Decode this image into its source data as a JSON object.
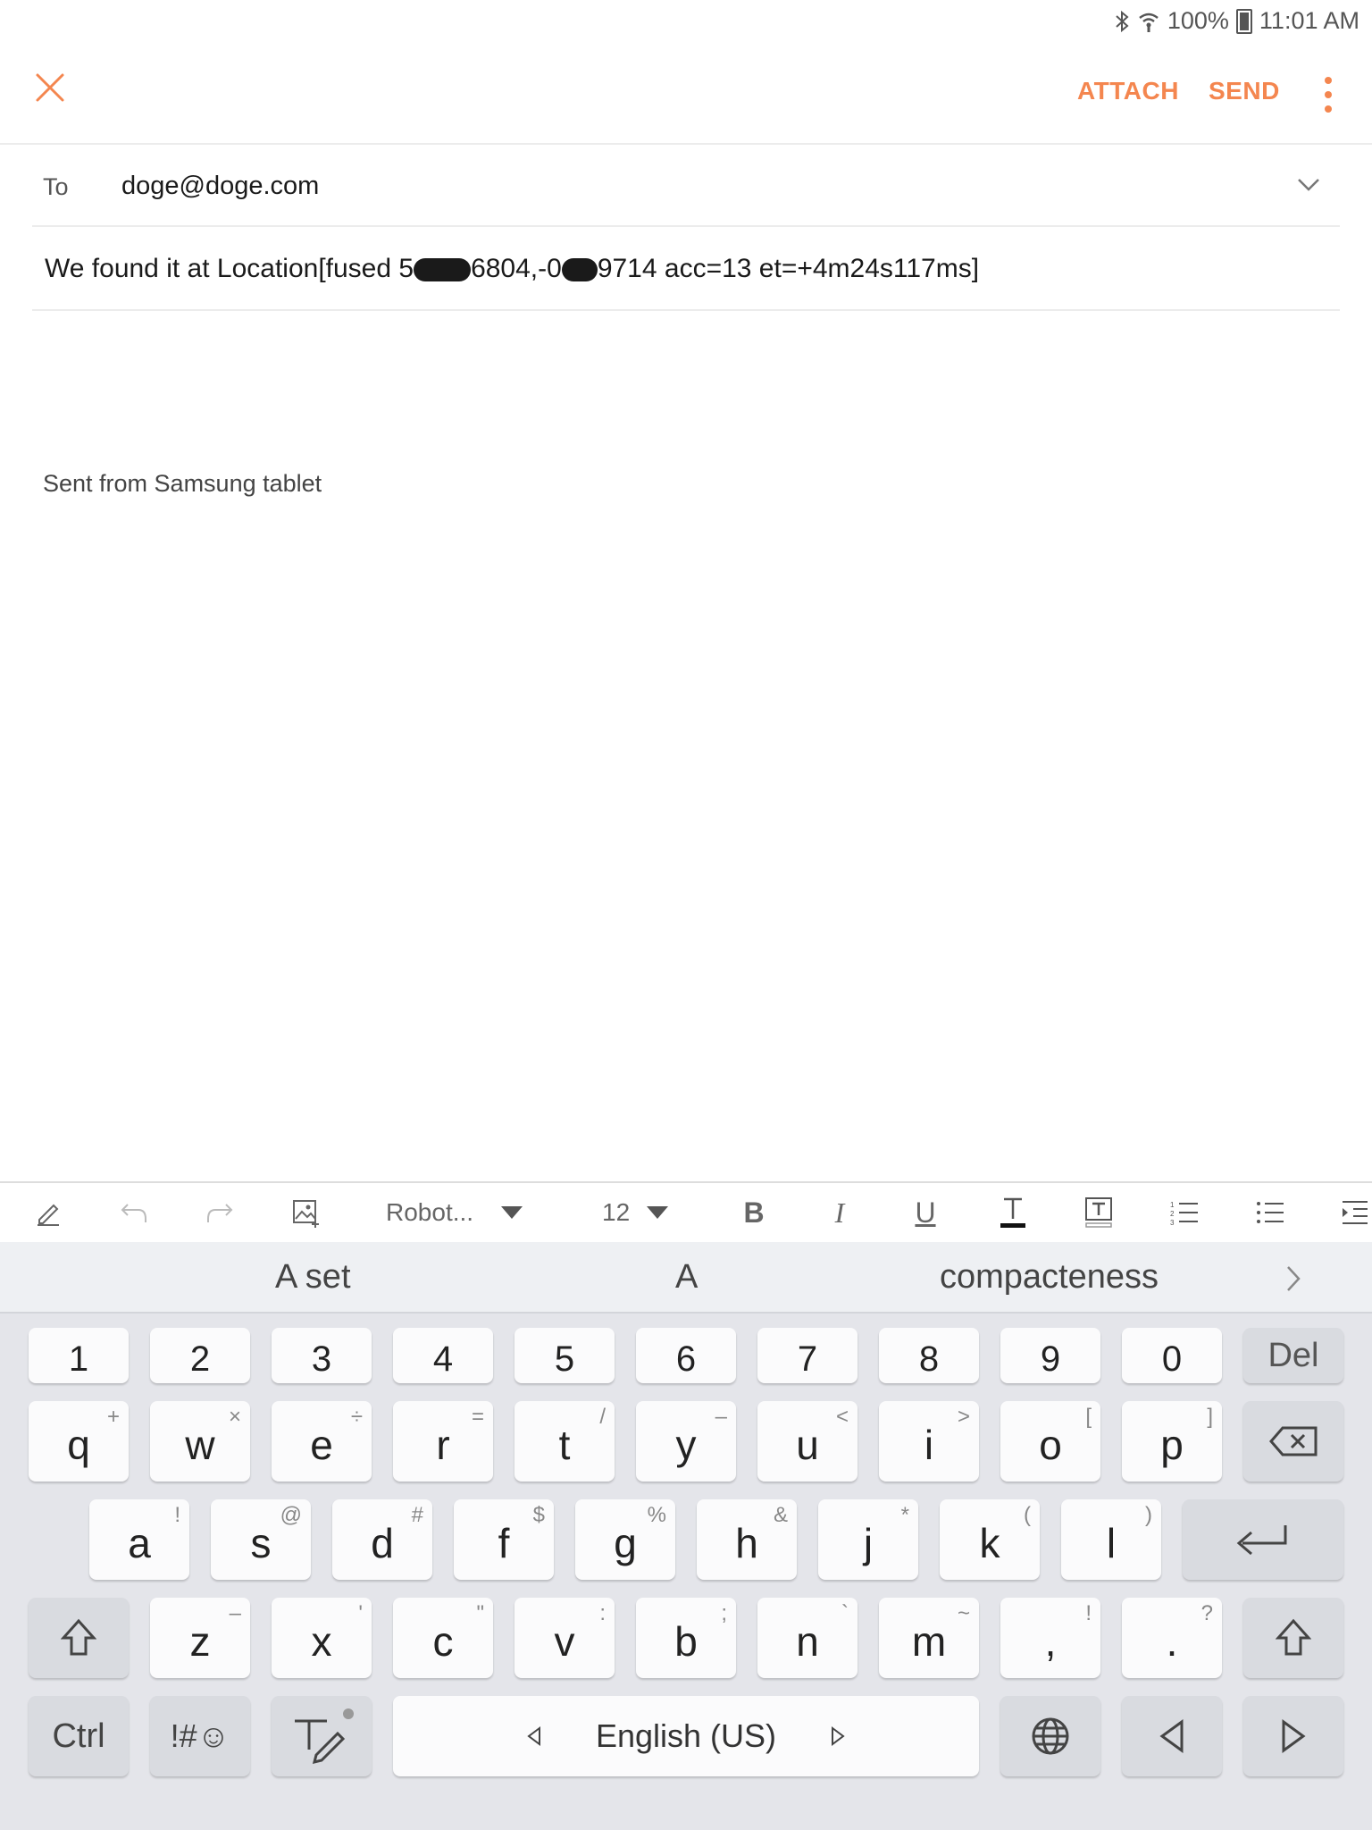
{
  "status_bar": {
    "battery": "100%",
    "time": "11:01 AM",
    "icons": [
      "bluetooth-icon",
      "wifi-icon",
      "battery-icon"
    ]
  },
  "app_bar": {
    "attach_label": "ATTACH",
    "send_label": "SEND",
    "accent_color": "#f4864f"
  },
  "compose": {
    "to_label": "To",
    "to_value": "doge@doge.com",
    "subject_parts": [
      "We found it at Location[fused 5",
      "6804,-0",
      "9714 acc=13 et=+4m24s117ms]"
    ],
    "signature": "Sent from Samsung tablet"
  },
  "format_toolbar": {
    "font_name": "Robot...",
    "font_size": "12"
  },
  "keyboard": {
    "suggestions": [
      "A set",
      "A",
      "compacteness"
    ],
    "number_row": [
      "1",
      "2",
      "3",
      "4",
      "5",
      "6",
      "7",
      "8",
      "9",
      "0"
    ],
    "del_label": "Del",
    "row_q": [
      {
        "k": "q",
        "s": "+"
      },
      {
        "k": "w",
        "s": "×"
      },
      {
        "k": "e",
        "s": "÷"
      },
      {
        "k": "r",
        "s": "="
      },
      {
        "k": "t",
        "s": "/"
      },
      {
        "k": "y",
        "s": "–"
      },
      {
        "k": "u",
        "s": "<"
      },
      {
        "k": "i",
        "s": ">"
      },
      {
        "k": "o",
        "s": "["
      },
      {
        "k": "p",
        "s": "]"
      }
    ],
    "row_a": [
      {
        "k": "a",
        "s": "!"
      },
      {
        "k": "s",
        "s": "@"
      },
      {
        "k": "d",
        "s": "#"
      },
      {
        "k": "f",
        "s": "$"
      },
      {
        "k": "g",
        "s": "%"
      },
      {
        "k": "h",
        "s": "&"
      },
      {
        "k": "j",
        "s": "*"
      },
      {
        "k": "k",
        "s": "("
      },
      {
        "k": "l",
        "s": ")"
      }
    ],
    "row_z": [
      {
        "k": "z",
        "s": "–"
      },
      {
        "k": "x",
        "s": "'"
      },
      {
        "k": "c",
        "s": "\""
      },
      {
        "k": "v",
        "s": ":"
      },
      {
        "k": "b",
        "s": ";"
      },
      {
        "k": "n",
        "s": "`"
      },
      {
        "k": "m",
        "s": "~"
      },
      {
        "k": ",",
        "s": "!"
      },
      {
        "k": ".",
        "s": "?"
      }
    ],
    "ctrl_label": "Ctrl",
    "symbols_label": "!#☺",
    "space_label": "English (US)"
  }
}
